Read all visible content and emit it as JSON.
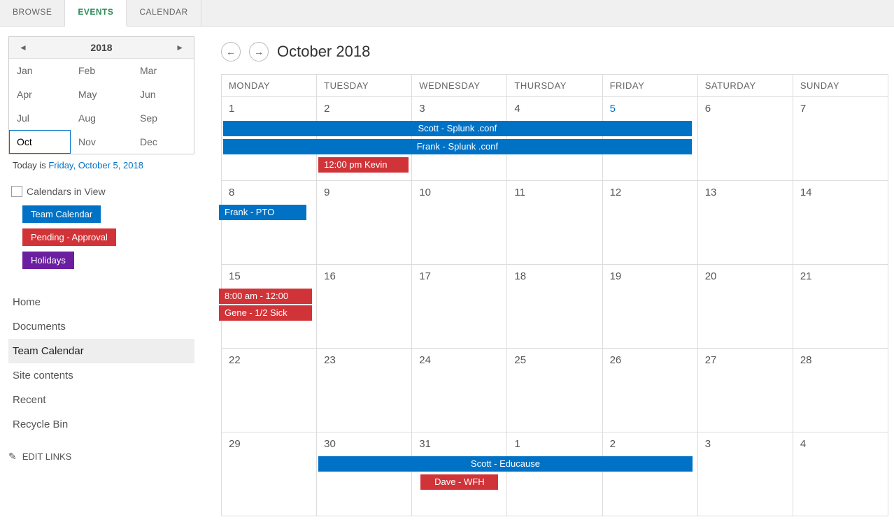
{
  "tabs": {
    "browse": "BROWSE",
    "events": "EVENTS",
    "calendar": "CALENDAR"
  },
  "mini": {
    "year": "2018",
    "months": [
      "Jan",
      "Feb",
      "Mar",
      "Apr",
      "May",
      "Jun",
      "Jul",
      "Aug",
      "Sep",
      "Oct",
      "Nov",
      "Dec"
    ],
    "selected": "Oct",
    "today_prefix": "Today is ",
    "today_link": "Friday, October 5, 2018"
  },
  "viewhead": "Calendars in View",
  "chips": {
    "team": "Team Calendar",
    "pending": "Pending - Approval",
    "holidays": "Holidays"
  },
  "nav": {
    "home": "Home",
    "documents": "Documents",
    "team": "Team Calendar",
    "site": "Site contents",
    "recent": "Recent",
    "recycle": "Recycle Bin"
  },
  "editlinks": "EDIT LINKS",
  "month_title": "October 2018",
  "dayheads": [
    "MONDAY",
    "TUESDAY",
    "WEDNESDAY",
    "THURSDAY",
    "FRIDAY",
    "SATURDAY",
    "SUNDAY"
  ],
  "weeks": [
    [
      "1",
      "2",
      "3",
      "4",
      "5",
      "6",
      "7"
    ],
    [
      "8",
      "9",
      "10",
      "11",
      "12",
      "13",
      "14"
    ],
    [
      "15",
      "16",
      "17",
      "18",
      "19",
      "20",
      "21"
    ],
    [
      "22",
      "23",
      "24",
      "25",
      "26",
      "27",
      "28"
    ],
    [
      "29",
      "30",
      "31",
      "1",
      "2",
      "3",
      "4"
    ]
  ],
  "events": {
    "scott_splunk": "Scott - Splunk .conf",
    "frank_splunk": "Frank - Splunk .conf",
    "kevin": "12:00 pm Kevin",
    "frank_pto": "Frank - PTO",
    "gene_time": "8:00 am - 12:00",
    "gene_sick": "Gene - 1/2 Sick",
    "scott_edu": "Scott - Educause",
    "dave_wfh": "Dave - WFH"
  }
}
